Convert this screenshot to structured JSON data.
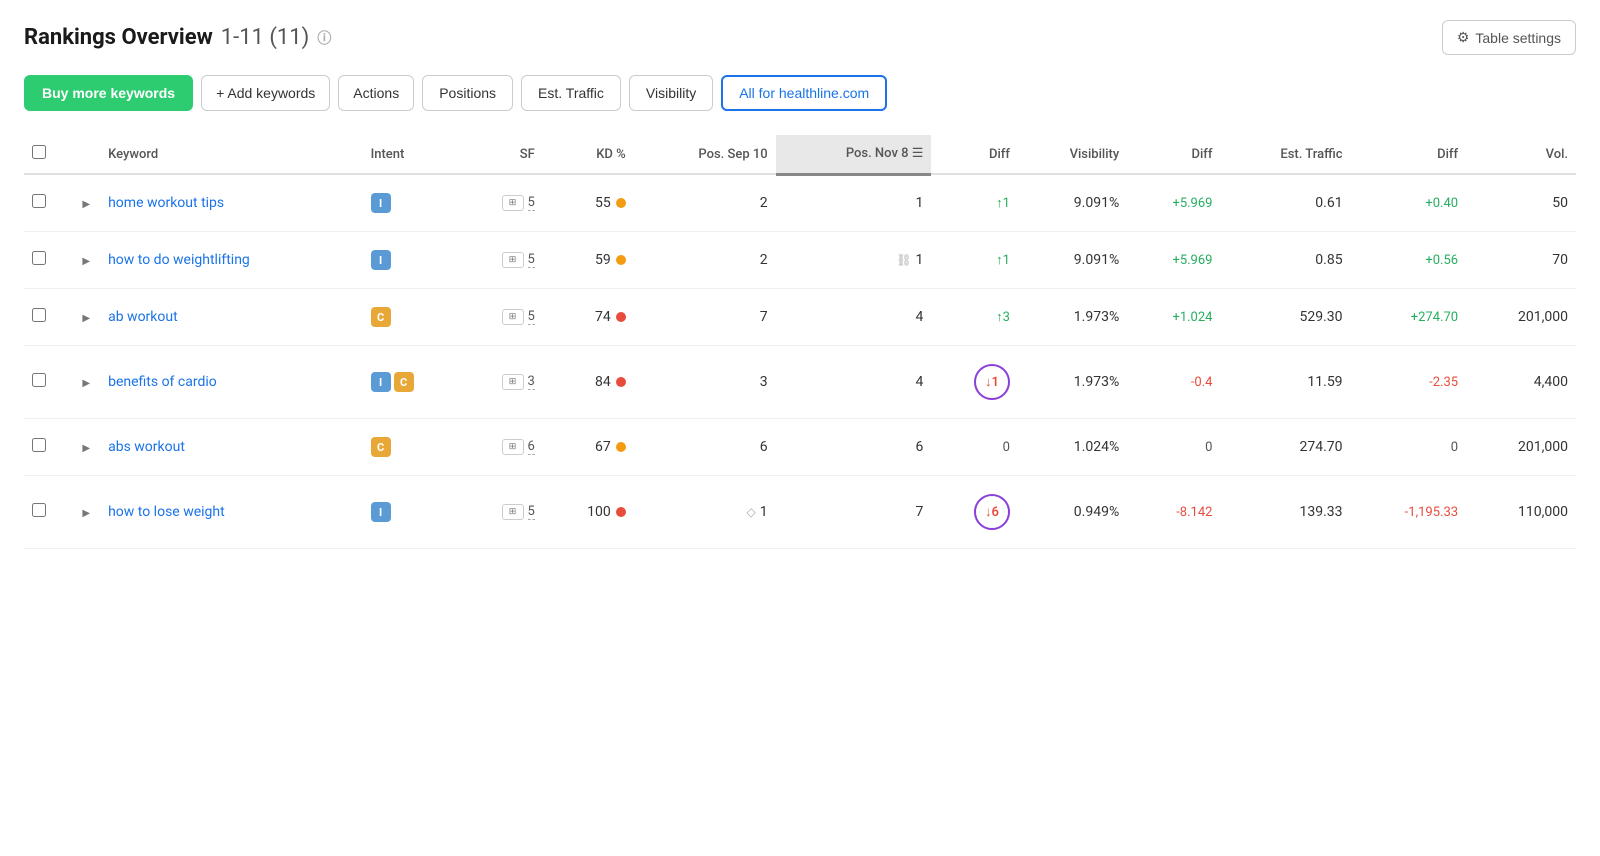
{
  "header": {
    "title": "Rankings Overview",
    "range": "1-11 (11)",
    "info_icon": "ℹ",
    "table_settings_label": "Table settings"
  },
  "toolbar": {
    "buy_keywords_label": "Buy more keywords",
    "add_keywords_label": "+ Add keywords",
    "actions_label": "Actions",
    "positions_label": "Positions",
    "est_traffic_label": "Est. Traffic",
    "visibility_label": "Visibility",
    "all_for_label": "All for healthline.com"
  },
  "table": {
    "columns": [
      {
        "id": "keyword",
        "label": "Keyword",
        "align": "left"
      },
      {
        "id": "intent",
        "label": "Intent",
        "align": "left"
      },
      {
        "id": "sf",
        "label": "SF",
        "align": "right"
      },
      {
        "id": "kd",
        "label": "KD %",
        "align": "right"
      },
      {
        "id": "pos_sep10",
        "label": "Pos. Sep 10",
        "align": "right"
      },
      {
        "id": "pos_nov8",
        "label": "Pos. Nov 8",
        "align": "right",
        "sorted": true
      },
      {
        "id": "diff1",
        "label": "Diff",
        "align": "right"
      },
      {
        "id": "visibility",
        "label": "Visibility",
        "align": "right"
      },
      {
        "id": "diff2",
        "label": "Diff",
        "align": "right"
      },
      {
        "id": "est_traffic",
        "label": "Est. Traffic",
        "align": "right"
      },
      {
        "id": "diff3",
        "label": "Diff",
        "align": "right"
      },
      {
        "id": "vol",
        "label": "Vol.",
        "align": "right"
      }
    ],
    "rows": [
      {
        "keyword": "home workout tips",
        "intent": [
          "I"
        ],
        "sf_icon": true,
        "sf_num": "5",
        "kd": "55",
        "kd_dot": "orange",
        "pos_sep10": "2",
        "pos_nov8": "1",
        "pos_nov8_icon": null,
        "diff1": "↑1",
        "diff1_type": "up",
        "visibility": "9.091%",
        "diff2": "+5.969",
        "diff2_type": "up",
        "est_traffic": "0.61",
        "diff3": "+0.40",
        "diff3_type": "up",
        "vol": "50",
        "circled": false
      },
      {
        "keyword": "how to do weightlifting",
        "intent": [
          "I"
        ],
        "sf_icon": true,
        "sf_num": "5",
        "kd": "59",
        "kd_dot": "orange",
        "pos_sep10": "2",
        "pos_nov8": "1",
        "pos_nov8_icon": "link",
        "diff1": "↑1",
        "diff1_type": "up",
        "visibility": "9.091%",
        "diff2": "+5.969",
        "diff2_type": "up",
        "est_traffic": "0.85",
        "diff3": "+0.56",
        "diff3_type": "up",
        "vol": "70",
        "circled": false
      },
      {
        "keyword": "ab workout",
        "intent": [
          "C"
        ],
        "sf_icon": true,
        "sf_num": "5",
        "kd": "74",
        "kd_dot": "red",
        "pos_sep10": "7",
        "pos_nov8": "4",
        "pos_nov8_icon": null,
        "diff1": "↑3",
        "diff1_type": "up",
        "visibility": "1.973%",
        "diff2": "+1.024",
        "diff2_type": "up",
        "est_traffic": "529.30",
        "diff3": "+274.70",
        "diff3_type": "up",
        "vol": "201,000",
        "circled": false
      },
      {
        "keyword": "benefits of cardio",
        "intent": [
          "I",
          "C"
        ],
        "sf_icon": true,
        "sf_num": "3",
        "kd": "84",
        "kd_dot": "red",
        "pos_sep10": "3",
        "pos_nov8": "4",
        "pos_nov8_icon": null,
        "diff1": "↓1",
        "diff1_type": "down",
        "visibility": "1.973%",
        "diff2": "-0.4",
        "diff2_type": "down",
        "est_traffic": "11.59",
        "diff3": "-2.35",
        "diff3_type": "down",
        "vol": "4,400",
        "circled": true
      },
      {
        "keyword": "abs workout",
        "intent": [
          "C"
        ],
        "sf_icon": true,
        "sf_num": "6",
        "kd": "67",
        "kd_dot": "orange",
        "pos_sep10": "6",
        "pos_nov8": "6",
        "pos_nov8_icon": null,
        "diff1": "0",
        "diff1_type": "neutral",
        "visibility": "1.024%",
        "diff2": "0",
        "diff2_type": "neutral",
        "est_traffic": "274.70",
        "diff3": "0",
        "diff3_type": "neutral",
        "vol": "201,000",
        "circled": false
      },
      {
        "keyword": "how to lose weight",
        "intent": [
          "I"
        ],
        "sf_icon": true,
        "sf_num": "5",
        "kd": "100",
        "kd_dot": "red",
        "pos_sep10": "1",
        "pos_sep10_icon": "diamond",
        "pos_nov8": "7",
        "pos_nov8_icon": null,
        "diff1": "↓6",
        "diff1_type": "down",
        "visibility": "0.949%",
        "diff2": "-8.142",
        "diff2_type": "down",
        "est_traffic": "139.33",
        "diff3": "-1,195.33",
        "diff3_type": "down",
        "vol": "110,000",
        "circled": true
      }
    ]
  }
}
